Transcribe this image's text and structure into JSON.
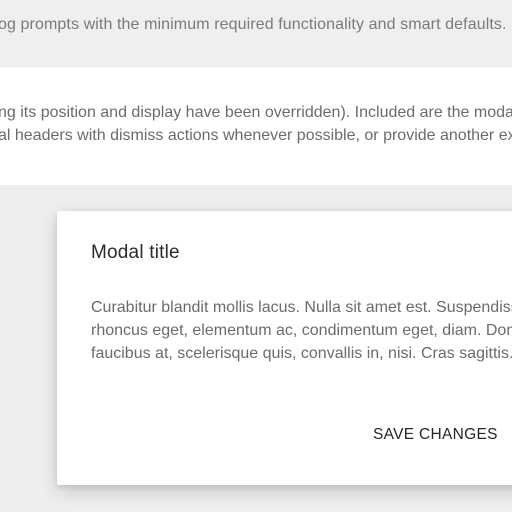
{
  "intro": {
    "text": "og prompts with the minimum required functionality and smart defaults."
  },
  "doc": {
    "line1": "ng its position and display have been overridden). Included are the modal h",
    "line2": "al headers with dismiss actions whenever possible, or provide another expli"
  },
  "modal": {
    "title": "Modal title",
    "body_lines": [
      "Curabitur blandit mollis lacus. Nulla sit amet est. Suspendisse",
      "rhoncus eget, elementum ac, condimentum eget, diam. Donec",
      "faucibus at, scelerisque quis, convallis in, nisi. Cras sagittis.."
    ],
    "save_label": "SAVE CHANGES"
  }
}
